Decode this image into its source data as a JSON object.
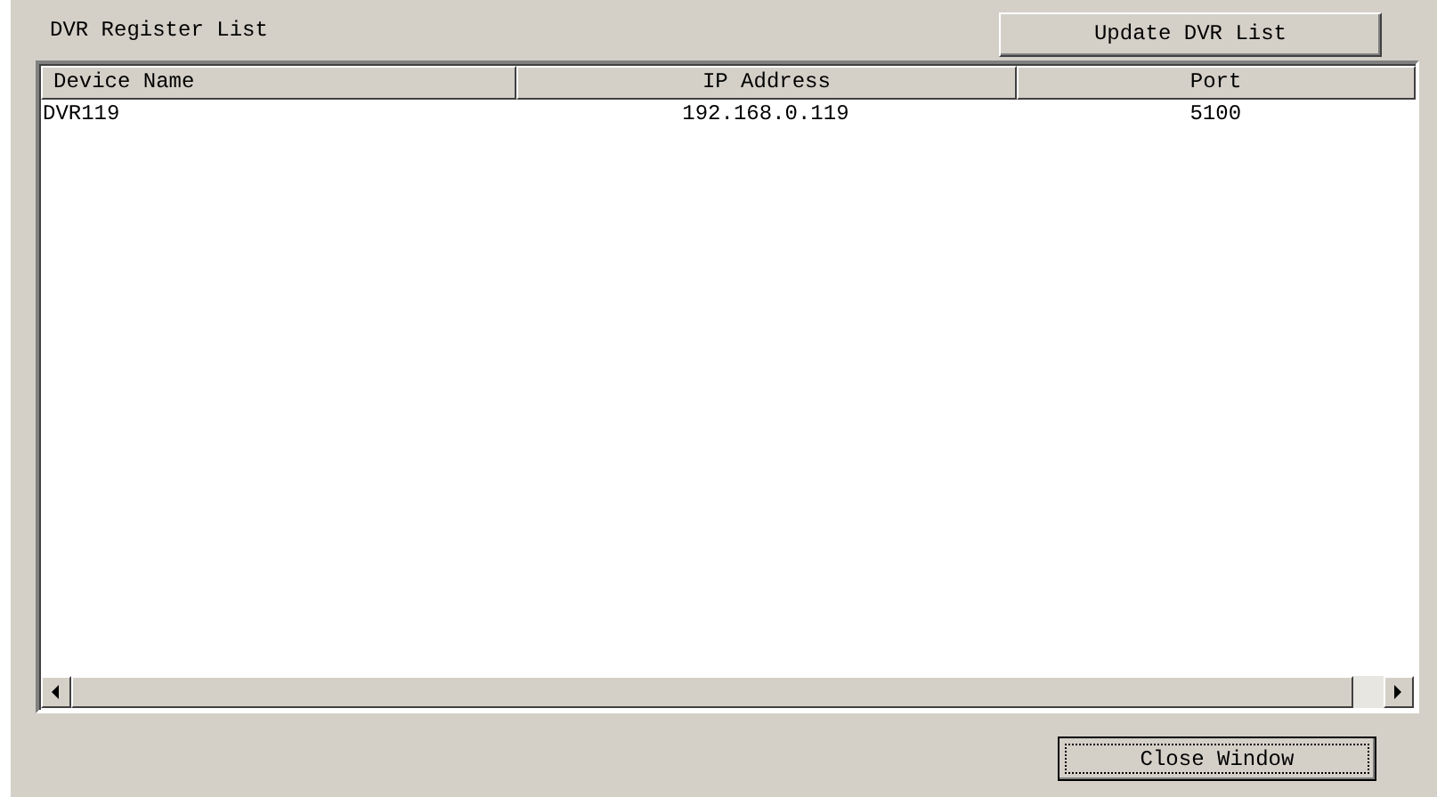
{
  "title": "DVR Register List",
  "update_button": "Update DVR List",
  "table": {
    "columns": [
      "Device Name",
      "IP Address",
      "Port"
    ],
    "rows": [
      [
        "DVR119",
        "192.168.0.119",
        "5100"
      ]
    ]
  },
  "close_button": "Close Window"
}
